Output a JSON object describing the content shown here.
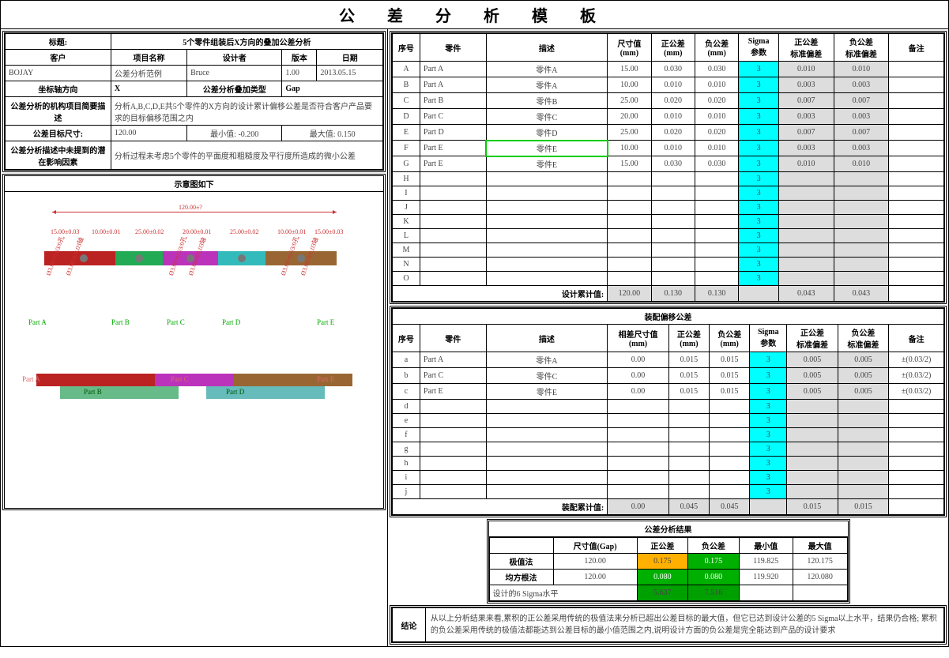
{
  "title": "公    差    分    析    模    板",
  "header": {
    "topic_lbl": "标题:",
    "topic": "5个零件组装后X方向的叠加公差分析",
    "customer_lbl": "客户",
    "proj_lbl": "项目名称",
    "designer_lbl": "设计者",
    "ver_lbl": "版本",
    "date_lbl": "日期",
    "customer": "BOJAY",
    "proj": "公差分析范例",
    "designer": "Bruce",
    "ver": "1.00",
    "date": "2013.05.15",
    "axis_lbl": "坐标轴方向",
    "axis": "X",
    "type_lbl": "公差分析叠加类型",
    "type": "Gap",
    "desc_lbl": "公差分析的机构项目简要描述",
    "desc": "分析A,B,C,D,E共5个零件的X方向的设计累计偏移公差是否符合客户产品要求的目标偏移范围之内",
    "target_lbl": "公差目标尺寸:",
    "target": "120.00",
    "min_lbl": "最小值:",
    "min": "-0.200",
    "max_lbl": "最大值:",
    "max": "0.150",
    "factor_lbl": "公差分析描述中未提到的潜在影响因素",
    "factor": "分析过程未考虑5个零件的平面度和粗糙度及平行度所造成的微小公差"
  },
  "diagram_title": "示意图如下",
  "diagram": {
    "top_dim": "120.00±?",
    "dims": [
      "15.00±0.03",
      "10.00±0.01",
      "25.00±0.02",
      "20.00±0.01",
      "25.00±0.02",
      "10.00±0.01",
      "15.00±0.03"
    ],
    "parts": [
      "Part A",
      "Part B",
      "Part C",
      "Part D",
      "Part E"
    ]
  },
  "table1": {
    "h": [
      "序号",
      "零件",
      "描述",
      "尺寸值\n(mm)",
      "正公差\n(mm)",
      "负公差\n(mm)",
      "Sigma\n参数",
      "正公差\n标准偏差",
      "负公差\n标准偏差",
      "备注"
    ],
    "rows": [
      [
        "A",
        "Part A",
        "零件A",
        "15.00",
        "0.030",
        "0.030",
        "3",
        "0.010",
        "0.010",
        ""
      ],
      [
        "B",
        "Part A",
        "零件A",
        "10.00",
        "0.010",
        "0.010",
        "3",
        "0.003",
        "0.003",
        ""
      ],
      [
        "C",
        "Part B",
        "零件B",
        "25.00",
        "0.020",
        "0.020",
        "3",
        "0.007",
        "0.007",
        ""
      ],
      [
        "D",
        "Part C",
        "零件C",
        "20.00",
        "0.010",
        "0.010",
        "3",
        "0.003",
        "0.003",
        ""
      ],
      [
        "E",
        "Part D",
        "零件D",
        "25.00",
        "0.020",
        "0.020",
        "3",
        "0.007",
        "0.007",
        ""
      ],
      [
        "F",
        "Part E",
        "零件E",
        "10.00",
        "0.010",
        "0.010",
        "3",
        "0.003",
        "0.003",
        ""
      ],
      [
        "G",
        "Part E",
        "零件E",
        "15.00",
        "0.030",
        "0.030",
        "3",
        "0.010",
        "0.010",
        ""
      ],
      [
        "H",
        "",
        "",
        "",
        "",
        "",
        "3",
        "",
        "",
        ""
      ],
      [
        "I",
        "",
        "",
        "",
        "",
        "",
        "3",
        "",
        "",
        ""
      ],
      [
        "J",
        "",
        "",
        "",
        "",
        "",
        "3",
        "",
        "",
        ""
      ],
      [
        "K",
        "",
        "",
        "",
        "",
        "",
        "3",
        "",
        "",
        ""
      ],
      [
        "L",
        "",
        "",
        "",
        "",
        "",
        "3",
        "",
        "",
        ""
      ],
      [
        "M",
        "",
        "",
        "",
        "",
        "",
        "3",
        "",
        "",
        ""
      ],
      [
        "N",
        "",
        "",
        "",
        "",
        "",
        "3",
        "",
        "",
        ""
      ],
      [
        "O",
        "",
        "",
        "",
        "",
        "",
        "3",
        "",
        "",
        ""
      ]
    ],
    "sum_lbl": "设计累计值:",
    "sum": [
      "120.00",
      "0.130",
      "0.130",
      "",
      "0.043",
      "0.043"
    ]
  },
  "table2": {
    "title": "装配偏移公差",
    "h": [
      "序号",
      "零件",
      "描述",
      "相差尺寸值\n(mm)",
      "正公差\n(mm)",
      "负公差\n(mm)",
      "Sigma\n参数",
      "正公差\n标准偏差",
      "负公差\n标准偏差",
      "备注"
    ],
    "rows": [
      [
        "a",
        "Part A",
        "零件A",
        "0.00",
        "0.015",
        "0.015",
        "3",
        "0.005",
        "0.005",
        "±(0.03/2)"
      ],
      [
        "b",
        "Part C",
        "零件C",
        "0.00",
        "0.015",
        "0.015",
        "3",
        "0.005",
        "0.005",
        "±(0.03/2)"
      ],
      [
        "c",
        "Part E",
        "零件E",
        "0.00",
        "0.015",
        "0.015",
        "3",
        "0.005",
        "0.005",
        "±(0.03/2)"
      ],
      [
        "d",
        "",
        "",
        "",
        "",
        "",
        "3",
        "",
        "",
        ""
      ],
      [
        "e",
        "",
        "",
        "",
        "",
        "",
        "3",
        "",
        "",
        ""
      ],
      [
        "f",
        "",
        "",
        "",
        "",
        "",
        "3",
        "",
        "",
        ""
      ],
      [
        "g",
        "",
        "",
        "",
        "",
        "",
        "3",
        "",
        "",
        ""
      ],
      [
        "h",
        "",
        "",
        "",
        "",
        "",
        "3",
        "",
        "",
        ""
      ],
      [
        "i",
        "",
        "",
        "",
        "",
        "",
        "3",
        "",
        "",
        ""
      ],
      [
        "j",
        "",
        "",
        "",
        "",
        "",
        "3",
        "",
        "",
        ""
      ]
    ],
    "sum_lbl": "装配累计值:",
    "sum": [
      "0.00",
      "0.045",
      "0.045",
      "",
      "0.015",
      "0.015"
    ]
  },
  "result": {
    "title": "公差分析结果",
    "h": [
      "",
      "尺寸值(Gap)",
      "正公差",
      "负公差",
      "最小值",
      "最大值"
    ],
    "r1": [
      "极值法",
      "120.00",
      "0.175",
      "0.175",
      "119.825",
      "120.175"
    ],
    "r2": [
      "均方根法",
      "120.00",
      "0.080",
      "0.080",
      "119.920",
      "120.080"
    ],
    "r3_lbl": "设计的6 Sigma水平",
    "r3a": "5.637",
    "r3b": "7.516"
  },
  "conclusion": {
    "lbl": "结论",
    "txt": "从以上分析结果来看,累积的正公差采用传统的极值法来分析已超出公差目标的最大值，但它已达到设计公差的5 Sigma以上水平，结果仍合格; 累积的负公差采用传统的极值法都能达到公差目标的最小值范围之内,说明设计方面的负公差是完全能达到产品的设计要求"
  }
}
